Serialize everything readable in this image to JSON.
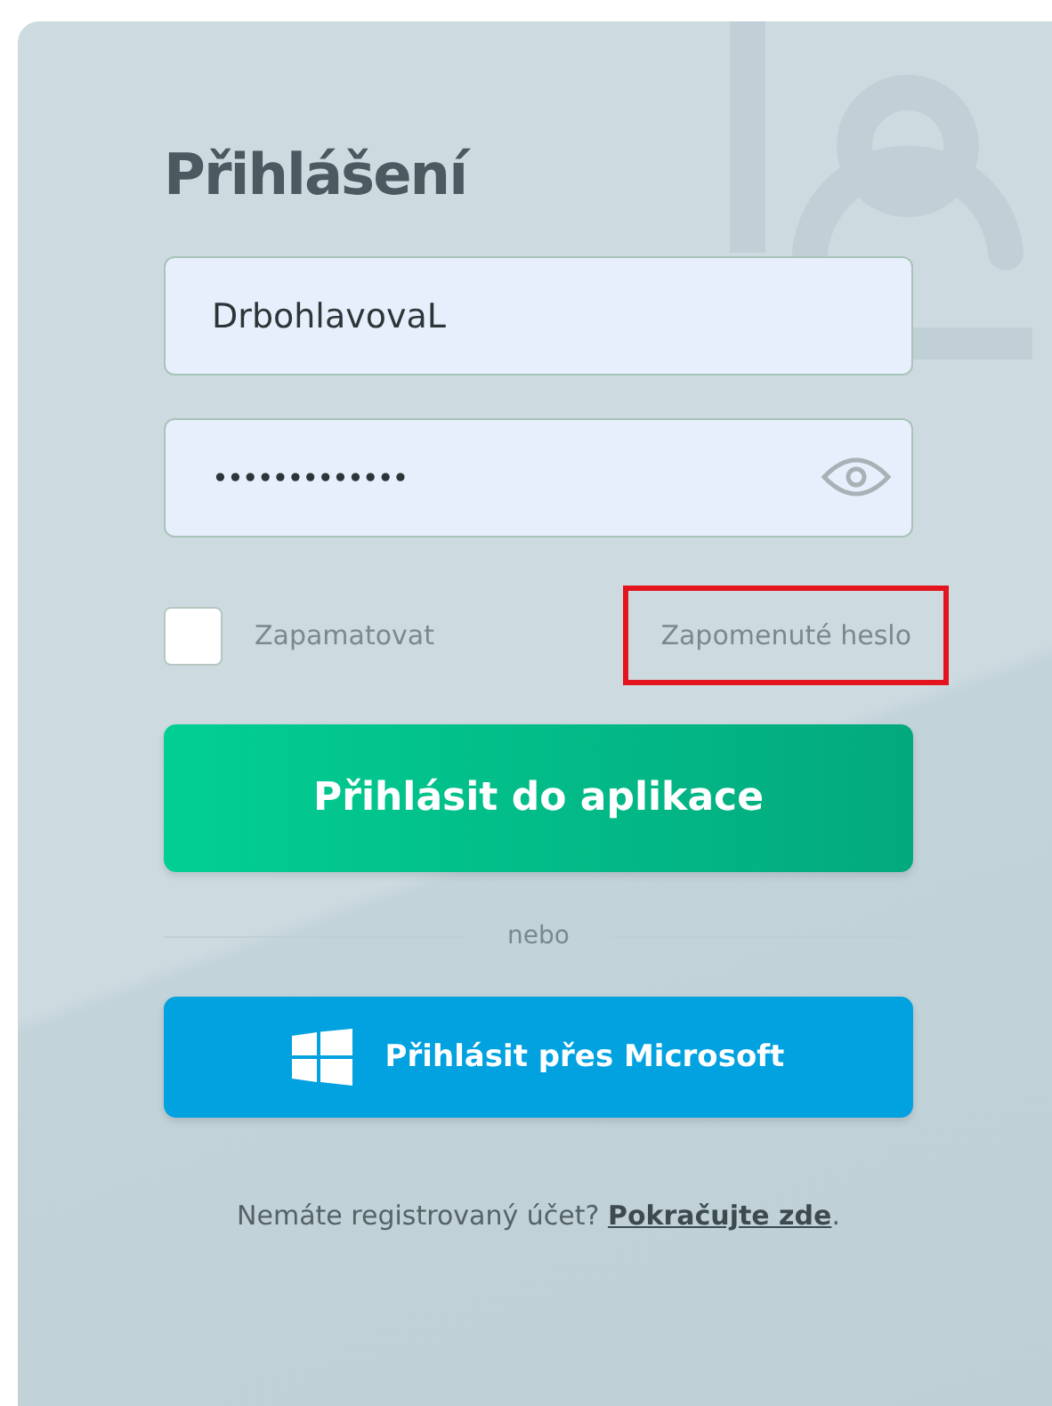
{
  "title": "Přihlášení",
  "username": {
    "value": "DrbohlavovaL"
  },
  "password": {
    "value": "•••••••••••••"
  },
  "remember": {
    "label": "Zapamatovat",
    "checked": false
  },
  "forgot_link": {
    "label": "Zapomenuté heslo",
    "highlighted": true
  },
  "login_button": "Přihlásit do aplikace",
  "divider": "nebo",
  "microsoft_button": "Přihlásit přes Microsoft",
  "footer": {
    "text": "Nemáte registrovaný účet?",
    "link": "Pokračujte zde",
    "end": "."
  }
}
